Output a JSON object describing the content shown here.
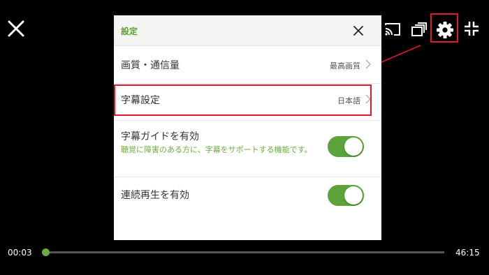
{
  "player": {
    "current_time": "00:03",
    "total_time": "46:15",
    "progress_fraction": 0.001,
    "accent_color": "#6aad3c",
    "icons": [
      "close-icon",
      "cast-icon",
      "episodes-icon",
      "gear-icon",
      "shrink-icon"
    ]
  },
  "dialog": {
    "title": "設定",
    "rows": [
      {
        "label": "画質・通信量",
        "value": "最高画質"
      },
      {
        "label": "字幕設定",
        "value": "日本語"
      },
      {
        "label": "字幕ガイドを有効",
        "sub": "聴覚に障害のある方に、字幕をサポートする機能です。",
        "toggle_on": true
      },
      {
        "label": "連続再生を有効",
        "toggle_on": true
      }
    ]
  },
  "annotation_color": "#e0192b"
}
